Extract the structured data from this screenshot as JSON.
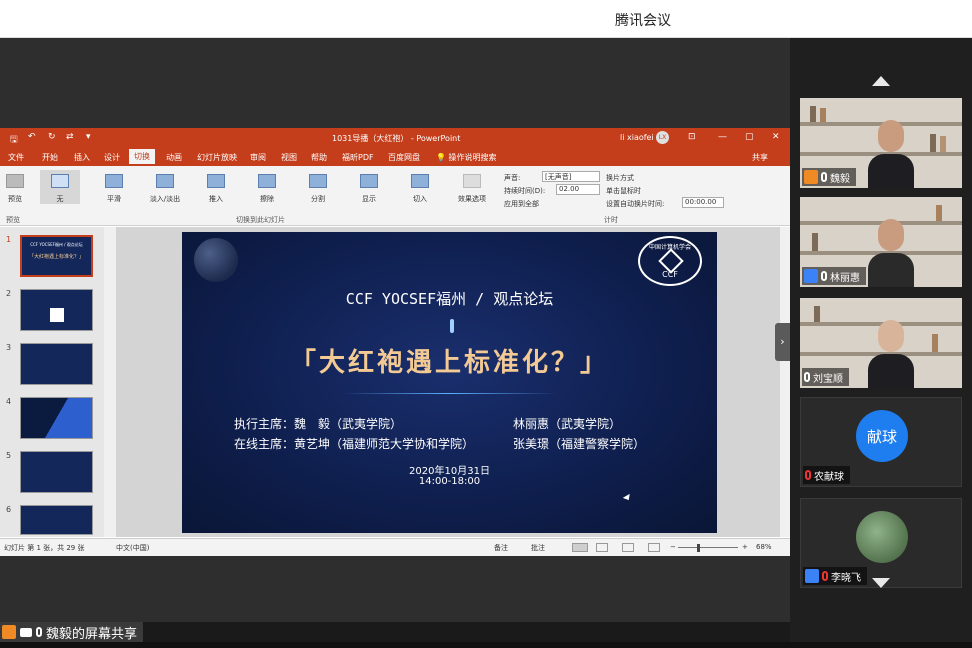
{
  "app_title": "腾讯会议",
  "ppt": {
    "doc_title": "1031导播（大红袍） - PowerPoint",
    "user": "li xiaofei",
    "avatar_initials": "LX",
    "window_controls": [
      "🖫",
      "↶",
      "↻",
      "⇄",
      "▾",
      "⊡",
      "—",
      "▢",
      "✕"
    ],
    "tabs": [
      "文件",
      "开始",
      "插入",
      "设计",
      "切换",
      "动画",
      "幻灯片放映",
      "审阅",
      "视图",
      "帮助",
      "福昕PDF",
      "百度网盘",
      "💡 操作说明搜索"
    ],
    "share": "共享",
    "transitions": [
      "无",
      "平滑",
      "淡入/淡出",
      "推入",
      "擦除",
      "分割",
      "显示",
      "切入"
    ],
    "preview_label": "预览",
    "effect_options": "效果选项",
    "group_transitions": "切换到此幻灯片",
    "group_preview": "预览",
    "group_timing": "计时",
    "sound_label": "声音:",
    "sound_value": "[无声音]",
    "duration_label": "持续时间(D):",
    "duration_value": "02.00",
    "apply_all": "应用到全部",
    "advance_label": "换片方式",
    "on_click": "单击鼠标时",
    "auto_after": "设置自动换片时间:",
    "auto_value": "00:00.00",
    "slide_numbers": [
      "1",
      "2",
      "3",
      "4",
      "5",
      "6"
    ],
    "thumb1_top": "CCF YOCSEF福州 / 观点论坛",
    "thumb1_main": "「大红袍遇上标准化？」",
    "status_left": "幻灯片 第 1 张，共 29 张",
    "status_lang": "中文(中国)",
    "notes": "备注",
    "comments": "批注",
    "zoom": "68%",
    "zoom_minus": "−",
    "zoom_plus": "+"
  },
  "slide": {
    "subtitle": "CCF YOCSEF福州 / 观点论坛",
    "title": "「大红袍遇上标准化？」",
    "exec_chair_1": "执行主席：魏　毅（武夷学院）",
    "exec_chair_2": "林丽惠（武夷学院）",
    "online_chair_1": "在线主席：黄艺坤（福建师范大学协和学院）",
    "online_chair_2": "张美璟（福建警察学院）",
    "date": "2020年10月31日",
    "time": "14:00-18:00",
    "logo_cn": "中国计算机学会",
    "logo_text": "CCF"
  },
  "participants": [
    {
      "name": "魏毅"
    },
    {
      "name": "林丽惠"
    },
    {
      "name": "刘宝顺"
    },
    {
      "name": "农献球",
      "badge": "献球"
    },
    {
      "name": "李晓飞"
    }
  ],
  "screen_share_label": "魏毅的屏幕共享",
  "nav": {
    "prev": "▲",
    "next": "▼",
    "slide_next": "›"
  }
}
